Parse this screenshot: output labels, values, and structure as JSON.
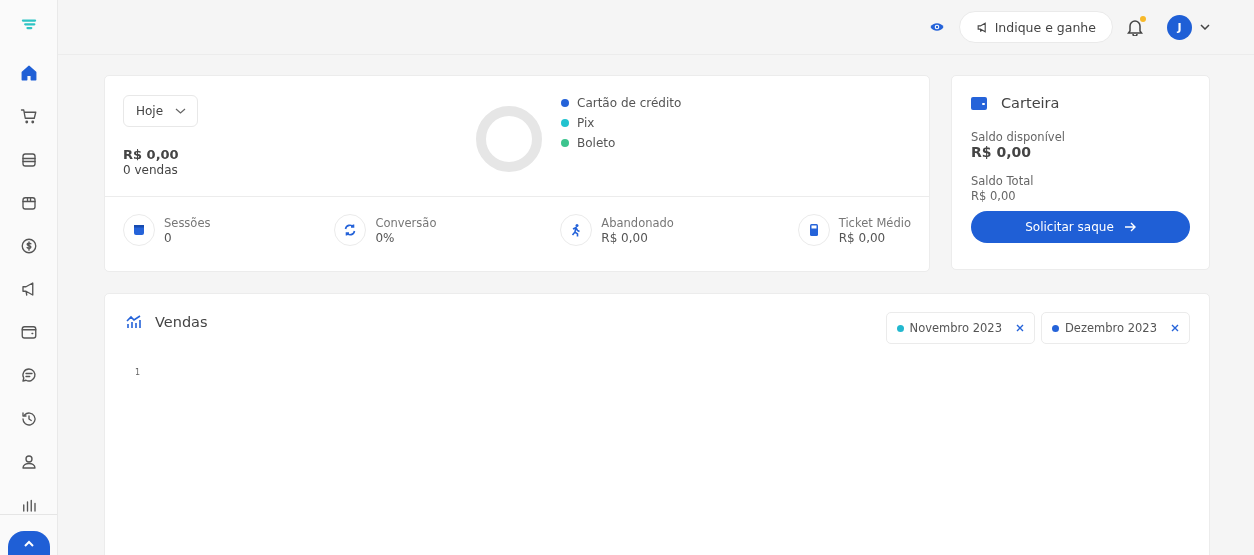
{
  "sidebar": {
    "items": [
      {
        "selected": true
      },
      {
        "selected": false
      },
      {
        "selected": false
      },
      {
        "selected": false
      },
      {
        "selected": false
      },
      {
        "selected": false
      },
      {
        "selected": false
      },
      {
        "selected": false
      },
      {
        "selected": false
      },
      {
        "selected": false
      },
      {
        "selected": false
      }
    ]
  },
  "topbar": {
    "referral_button": "Indique e ganhe",
    "notification_unread": true,
    "avatar_initial": "J"
  },
  "summary": {
    "period": "Hoje",
    "total": "R$ 0,00",
    "sales_count": "0 vendas",
    "payment_methods": [
      {
        "label": "Cartão de crédito",
        "color": "#2563d9"
      },
      {
        "label": "Pix",
        "color": "#22c3cf"
      },
      {
        "label": "Boleto",
        "color": "#3cc48e"
      }
    ],
    "metrics": [
      {
        "kind": "sessions",
        "label": "Sessões",
        "value": "0"
      },
      {
        "kind": "conversion",
        "label": "Conversão",
        "value": "0%"
      },
      {
        "kind": "abandoned",
        "label": "Abandonado",
        "value": "R$ 0,00"
      },
      {
        "kind": "ticket",
        "label": "Ticket Médio",
        "value": "R$ 0,00"
      }
    ]
  },
  "wallet": {
    "title": "Carteira",
    "available_label": "Saldo disponível",
    "available_value": "R$ 0,00",
    "total_label": "Saldo Total",
    "total_value": "R$ 0,00",
    "button": "Solicitar saque"
  },
  "sales": {
    "title": "Vendas",
    "axis_tick": "1",
    "periods": [
      {
        "label": "Novembro 2023",
        "color": "#22b8cf"
      },
      {
        "label": "Dezembro 2023",
        "color": "#2563d9"
      }
    ]
  }
}
